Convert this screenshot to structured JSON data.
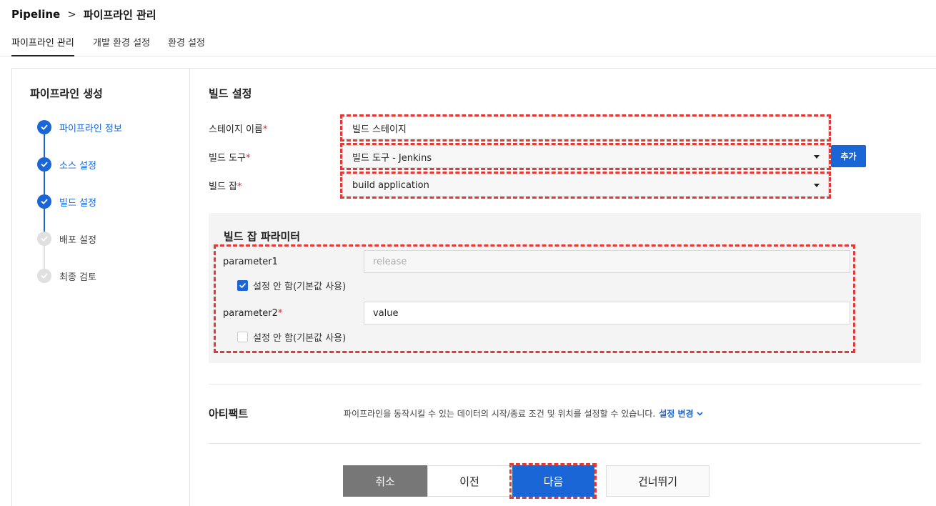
{
  "breadcrumb": {
    "root": "Pipeline",
    "separator": ">",
    "current": "파이프라인 관리"
  },
  "tabs": [
    {
      "label": "파이프라인 관리",
      "active": true
    },
    {
      "label": "개발 환경 설정",
      "active": false
    },
    {
      "label": "환경 설정",
      "active": false
    }
  ],
  "sidebar": {
    "title": "파이프라인 생성",
    "steps": [
      {
        "label": "파이프라인 정보",
        "status": "done"
      },
      {
        "label": "소스 설정",
        "status": "done"
      },
      {
        "label": "빌드 설정",
        "status": "done"
      },
      {
        "label": "배포 설정",
        "status": "todo"
      },
      {
        "label": "최종 검토",
        "status": "todo"
      }
    ]
  },
  "build": {
    "title": "빌드 설정",
    "required_mark": "*",
    "stage_name": {
      "label": "스테이지 이름",
      "value": "빌드 스테이지"
    },
    "build_tool": {
      "label": "빌드 도구",
      "value": "빌드 도구 - Jenkins",
      "add_label": "추가"
    },
    "build_job": {
      "label": "빌드 잡",
      "value": "build application"
    }
  },
  "params": {
    "title": "빌드 잡 파라미터",
    "items": [
      {
        "label": "parameter1",
        "required": false,
        "placeholder": "release",
        "value": "",
        "checkbox_label": "설정 안 함(기본값 사용)",
        "checked": true
      },
      {
        "label": "parameter2",
        "required": true,
        "placeholder": "",
        "value": "value",
        "checkbox_label": "설정 안 함(기본값 사용)",
        "checked": false
      }
    ]
  },
  "artifact": {
    "title": "아티팩트",
    "description": "파이프라인을 동작시킬 수 있는 데이터의 시작/종료 조건 및 위치를 설정할 수 있습니다.",
    "link_label": "설정 변경"
  },
  "buttons": {
    "cancel": "취소",
    "prev": "이전",
    "next": "다음",
    "skip": "건너뛰기"
  },
  "colors": {
    "accent": "#1a66d6",
    "highlight": "#e53935",
    "cancel_bg": "#777777"
  },
  "icons": {
    "step_done": "check-icon",
    "step_todo": "check-icon",
    "select": "caret-down-icon",
    "link": "chevron-down-icon"
  }
}
